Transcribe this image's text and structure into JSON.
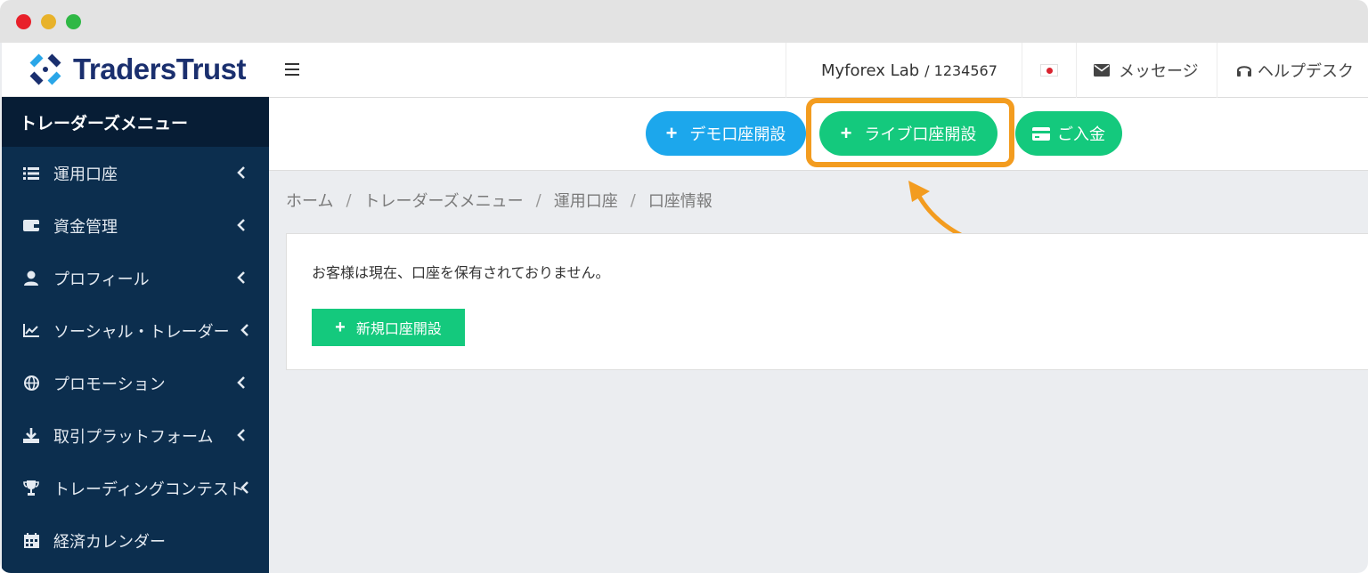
{
  "brand": {
    "logo_text": "TradersTrust"
  },
  "sidebar": {
    "header": "トレーダーズメニュー",
    "items": [
      {
        "label": "運用口座",
        "icon": "list-icon"
      },
      {
        "label": "資金管理",
        "icon": "wallet-icon"
      },
      {
        "label": "プロフィール",
        "icon": "user-icon"
      },
      {
        "label": "ソーシャル・トレーダー",
        "icon": "chart-line-icon"
      },
      {
        "label": "プロモーション",
        "icon": "globe-icon"
      },
      {
        "label": "取引プラットフォーム",
        "icon": "download-icon"
      },
      {
        "label": "トレーディングコンテスト",
        "icon": "trophy-icon"
      },
      {
        "label": "経済カレンダー",
        "icon": "calendar-icon"
      }
    ]
  },
  "topbar": {
    "user_name": "Myforex Lab",
    "account_number": "/ 1234567",
    "messages_label": "メッセージ",
    "helpdesk_label": "ヘルプデスク"
  },
  "actions": {
    "demo_label": "デモ口座開設",
    "live_label": "ライブ口座開設",
    "deposit_label": "ご入金"
  },
  "breadcrumb": [
    "ホーム",
    "トレーダーズメニュー",
    "運用口座",
    "口座情報"
  ],
  "content": {
    "message": "お客様は現在、口座を保有されておりません。",
    "new_account_label": "新規口座開設"
  },
  "colors": {
    "sidebar_bg": "#0c2e4e",
    "sidebar_header_bg": "#071d35",
    "demo_blue": "#1ca7ec",
    "live_green": "#14c97d",
    "highlight_orange": "#f39c1f"
  }
}
